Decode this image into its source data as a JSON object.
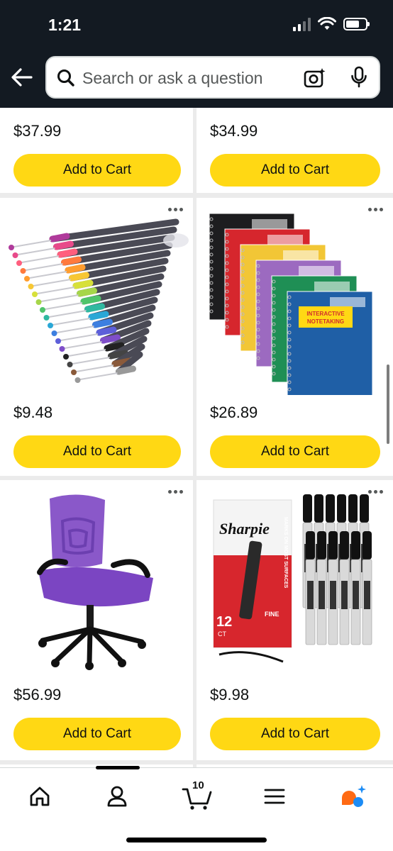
{
  "status": {
    "time": "1:21"
  },
  "search": {
    "placeholder": "Search or ask a question"
  },
  "products": [
    {
      "price": "$37.99",
      "cta": "Add to Cart"
    },
    {
      "price": "$34.99",
      "cta": "Add to Cart"
    },
    {
      "price": "$9.48",
      "cta": "Add to Cart",
      "image": "fine-tip-color-pens"
    },
    {
      "price": "$26.89",
      "cta": "Add to Cart",
      "image": "five-star-spiral-notebooks"
    },
    {
      "price": "$56.99",
      "cta": "Add to Cart",
      "image": "purple-mesh-office-chair"
    },
    {
      "price": "$9.98",
      "cta": "Add to Cart",
      "image": "sharpie-permanent-markers"
    }
  ],
  "notebook_cover": {
    "line1": "INTERACTIVE",
    "line2": "NOTETAKING"
  },
  "sharpie_box": {
    "brand": "Sharpie",
    "count": "12",
    "count_unit": "CT",
    "tip": "FINE",
    "side_text": "MARKS ON MOST SURFACES"
  },
  "nav": {
    "cart_count": "10"
  },
  "colors": {
    "header": "#131a22",
    "cta": "#ffd814",
    "background": "#ebebeb"
  }
}
